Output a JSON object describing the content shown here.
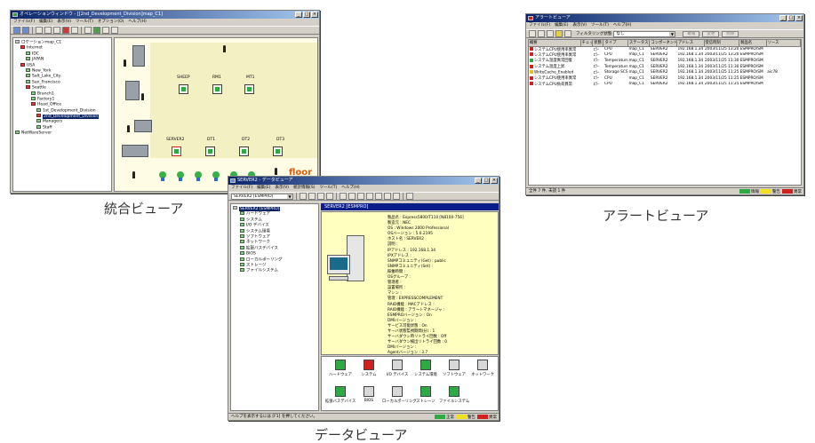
{
  "integrated_viewer": {
    "title": "オペレーションウィンドウ - [[2nd_Development_Division]map_C1]",
    "menu": [
      "ファイル(F)",
      "編集(E)",
      "表示(V)",
      "ツール(T)",
      "オプション(O)",
      "ヘルプ(H)"
    ],
    "tree": [
      {
        "label": "ロケーションmap_C1",
        "indent": 0,
        "icon": "gray"
      },
      {
        "label": "Internet",
        "indent": 1,
        "icon": "red"
      },
      {
        "label": "IDC",
        "indent": 2,
        "icon": "green"
      },
      {
        "label": "JAPAN",
        "indent": 2,
        "icon": "green"
      },
      {
        "label": "USA",
        "indent": 1,
        "icon": "red"
      },
      {
        "label": "New_York",
        "indent": 2,
        "icon": "green"
      },
      {
        "label": "Salt_Lake_City",
        "indent": 2,
        "icon": "green"
      },
      {
        "label": "San_Francisco",
        "indent": 2,
        "icon": "green"
      },
      {
        "label": "Seattle",
        "indent": 2,
        "icon": "red"
      },
      {
        "label": "Branch1",
        "indent": 3,
        "icon": "green"
      },
      {
        "label": "Factory1",
        "indent": 3,
        "icon": "green"
      },
      {
        "label": "Head_Office",
        "indent": 3,
        "icon": "red"
      },
      {
        "label": "1st_Development_Division",
        "indent": 4,
        "icon": "green"
      },
      {
        "label": "2nd_Development_Division",
        "indent": 4,
        "icon": "red",
        "selected": true
      },
      {
        "label": "Managers",
        "indent": 4,
        "icon": "green"
      },
      {
        "label": "Staff",
        "indent": 4,
        "icon": "green"
      },
      {
        "label": "NetWareServer",
        "indent": 0,
        "icon": "green"
      }
    ],
    "map_labels": [
      "SHEEP",
      "RM1",
      "MT1",
      "SERVER2",
      "DT1",
      "DT2",
      "DT3"
    ],
    "floor_label": "floor",
    "caption": "統合ビューア"
  },
  "alert_viewer": {
    "title": "アラートビューア",
    "menu": [
      "ファイル(F)",
      "編集(E)",
      "表示(V)",
      "ツール(T)",
      "ヘルプ(H)"
    ],
    "filter_label": "フィルタリング状態",
    "filter_value": "なし",
    "toolbar_buttons": [
      "確報",
      "変更",
      "削除"
    ],
    "columns": [
      "概要",
      "チェック",
      "状態",
      "タイプ",
      "ステータス",
      "コンポーネント",
      "アドレス",
      "受信時刻",
      "製品名",
      "ソース"
    ],
    "rows": [
      {
        "summary": "システムCPU使用率異常",
        "state": "ｴﾗｰ",
        "type": "CPU",
        "status": "map_C1",
        "component": "SERVER2",
        "address": "192.168.1.34",
        "time": "2003/11/25 13:20",
        "product": "ESMPRO/SM",
        "source": "",
        "color": "#d02020"
      },
      {
        "summary": "システムCPU使用率異常",
        "state": "ｴﾗｰ",
        "type": "CPU",
        "status": "map_C1",
        "component": "SERVER2",
        "address": "192.168.1.34",
        "time": "2003/11/25 13:20",
        "product": "ESMPRO/SM",
        "source": "",
        "color": "#d02020"
      },
      {
        "summary": "システム温度異常回復",
        "state": "ｴﾗｰ",
        "type": "Temperature",
        "status": "map_C1",
        "component": "SERVER2",
        "address": "192.168.1.34",
        "time": "2003/11/25 11:30",
        "product": "ESMPRO/SM",
        "source": "",
        "color": "#2eaa44"
      },
      {
        "summary": "システム温度上昇",
        "state": "ｴﾗｰ",
        "type": "Temperature",
        "status": "map_C1",
        "component": "SERVER2",
        "address": "192.168.1.34",
        "time": "2003/11/25 11:30",
        "product": "ESMPRO/SM",
        "source": "",
        "color": "#d02020"
      },
      {
        "summary": "WriteCache_Enabled",
        "state": "ｴﾗｰ",
        "type": "Storage SCSI...",
        "status": "map_C1",
        "component": "SERVER2",
        "address": "192.168.1.34",
        "time": "2003/11/25 11:25",
        "product": "ESMPRO/SM",
        "source": "aic78",
        "color": "#e6c020"
      },
      {
        "summary": "システムCPU使用率異常",
        "state": "ｴﾗｰ",
        "type": "CPU",
        "status": "map_C1",
        "component": "SERVER2",
        "address": "192.168.1.34",
        "time": "2003/11/25 11:25",
        "product": "ESMPRO/SM",
        "source": "",
        "color": "#d02020"
      },
      {
        "summary": "システムCPU負荷異常",
        "state": "ｴﾗｰ",
        "type": "CPU",
        "status": "map_C1",
        "component": "SERVER2",
        "address": "192.168.1.34",
        "time": "2003/11/25 11:25",
        "product": "ESMPRO/SM",
        "source": "",
        "color": "#d02020"
      }
    ],
    "status_text": "全件 7 件, 未読 1 件",
    "legend": [
      {
        "label": "情報",
        "color": "#2eaa44"
      },
      {
        "label": "警告",
        "color": "#f0e020"
      },
      {
        "label": "異常",
        "color": "#d02020"
      }
    ],
    "caption": "アラートビューア"
  },
  "data_viewer": {
    "title": "SERVER2 - データビューア",
    "menu": [
      "ファイル(F)",
      "編集(E)",
      "表示(V)",
      "統計情報(S)",
      "ツール(T)",
      "ヘルプ(H)"
    ],
    "server_select": "SERVER2 [ESMPRO]",
    "header": "SERVER2 [ESMPRO]",
    "tree": [
      {
        "label": "SERVER2 [ESMPRO]",
        "indent": 0,
        "selected": true
      },
      {
        "label": "ハードウェア",
        "indent": 1
      },
      {
        "label": "システム",
        "indent": 1
      },
      {
        "label": "I/O デバイス",
        "indent": 1
      },
      {
        "label": "システム環境",
        "indent": 1
      },
      {
        "label": "ソフトウェア",
        "indent": 1
      },
      {
        "label": "ネットワーク",
        "indent": 1
      },
      {
        "label": "拡張バスデバイス",
        "indent": 1
      },
      {
        "label": "BIOS",
        "indent": 1
      },
      {
        "label": "ローカルポーリング",
        "indent": 1
      },
      {
        "label": "ストレージ",
        "indent": 1
      },
      {
        "label": "ファイルシステム",
        "indent": 1
      }
    ],
    "info_lines": [
      "製品名 : Express5800/T110 [N8100-756]",
      "製造元 : NEC",
      "OS : Windows 2000 Professional",
      "OSバージョン : 5.0.2195",
      "ホスト名 : SERVER2",
      "説明 :",
      "IPアドレス : 192.168.1.34",
      "IPXアドレス :",
      "SNMPコミュニティ(Get) : public",
      "SNMPコミュニティ(Set) :",
      "稼働時間 :",
      "OSグループ :",
      "管理者 :",
      "設置場所 :",
      "マシン :",
      "管理 : EXPRESSCOMPLEMENT",
      "RAID機能 : MACアドレス :",
      "RAID機能 : アラートマネージャ :",
      "ESMPROバージョン : On",
      "DMIバージョン :",
      "サービス可能状態 : On",
      "サーバ状態監視期間(分) : 1",
      "サーバダウン時リトライ回数 : Off",
      "サーバダウン検出リトライ回数 : 0",
      "DMIバージョン :",
      "Agentバージョン : 3.7",
      "OS名(Management Console用) :",
      "OSバージョン(Management Console用) :",
      "ボード番号(Management Console用) :"
    ],
    "icons": [
      {
        "label": "ハードウェア",
        "color": "#2eaa44"
      },
      {
        "label": "システム",
        "color": "#d02020"
      },
      {
        "label": "I/O デバイス",
        "color": "#d8d8d8"
      },
      {
        "label": "システム環境",
        "color": "#2eaa44"
      },
      {
        "label": "ソフトウェア",
        "color": "#d8d8d8"
      },
      {
        "label": "ネットワーク",
        "color": "#d8d8d8"
      },
      {
        "label": "拡張バスデバイス",
        "color": "#2eaa44"
      },
      {
        "label": "BIOS",
        "color": "#d8d8d8"
      },
      {
        "label": "ローカルポーリング",
        "color": "#d8d8d8"
      },
      {
        "label": "ストレージ",
        "color": "#2eaa44"
      },
      {
        "label": "ファイルシステム",
        "color": "#2eaa44"
      }
    ],
    "status_text": "ヘルプを表示するには [F1] を押してください。",
    "legend": [
      {
        "label": "正常",
        "color": "#2eaa44"
      },
      {
        "label": "警告",
        "color": "#f0e020"
      },
      {
        "label": "異常",
        "color": "#d02020"
      }
    ],
    "caption": "データビューア"
  }
}
